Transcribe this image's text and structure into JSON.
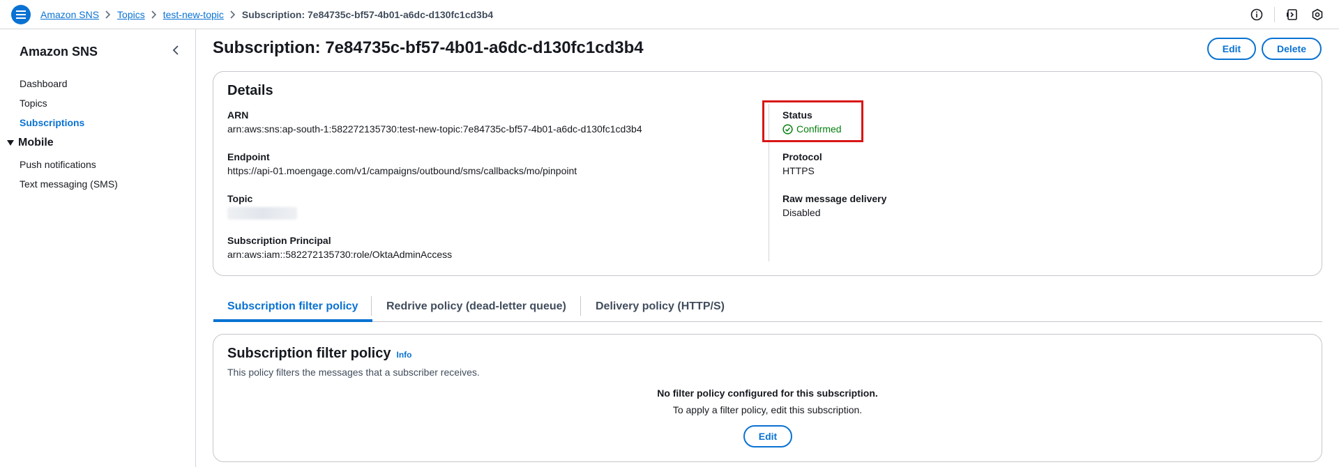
{
  "breadcrumb": {
    "items": [
      "Amazon SNS",
      "Topics",
      "test-new-topic"
    ],
    "current": "Subscription: 7e84735c-bf57-4b01-a6dc-d130fc1cd3b4"
  },
  "sidebar": {
    "title": "Amazon SNS",
    "items": [
      {
        "label": "Dashboard"
      },
      {
        "label": "Topics"
      },
      {
        "label": "Subscriptions"
      }
    ],
    "section": {
      "label": "Mobile",
      "items": [
        {
          "label": "Push notifications"
        },
        {
          "label": "Text messaging (SMS)"
        }
      ]
    }
  },
  "page": {
    "title": "Subscription: 7e84735c-bf57-4b01-a6dc-d130fc1cd3b4",
    "edit_label": "Edit",
    "delete_label": "Delete"
  },
  "details": {
    "heading": "Details",
    "arn_label": "ARN",
    "arn_value": "arn:aws:sns:ap-south-1:582272135730:test-new-topic:7e84735c-bf57-4b01-a6dc-d130fc1cd3b4",
    "endpoint_label": "Endpoint",
    "endpoint_value": "https://api-01.moengage.com/v1/campaigns/outbound/sms/callbacks/mo/pinpoint",
    "topic_label": "Topic",
    "principal_label": "Subscription Principal",
    "principal_value": "arn:aws:iam::582272135730:role/OktaAdminAccess",
    "status_label": "Status",
    "status_value": "Confirmed",
    "protocol_label": "Protocol",
    "protocol_value": "HTTPS",
    "raw_label": "Raw message delivery",
    "raw_value": "Disabled"
  },
  "tabs": [
    {
      "label": "Subscription filter policy",
      "active": true
    },
    {
      "label": "Redrive policy (dead-letter queue)",
      "active": false
    },
    {
      "label": "Delivery policy (HTTP/S)",
      "active": false
    }
  ],
  "filter": {
    "heading": "Subscription filter policy",
    "info": "Info",
    "description": "This policy filters the messages that a subscriber receives.",
    "empty_title": "No filter policy configured for this subscription.",
    "empty_sub": "To apply a filter policy, edit this subscription.",
    "edit_label": "Edit"
  },
  "colors": {
    "accent": "#0972d3",
    "success": "#037f0c",
    "highlight": "#d91515"
  }
}
